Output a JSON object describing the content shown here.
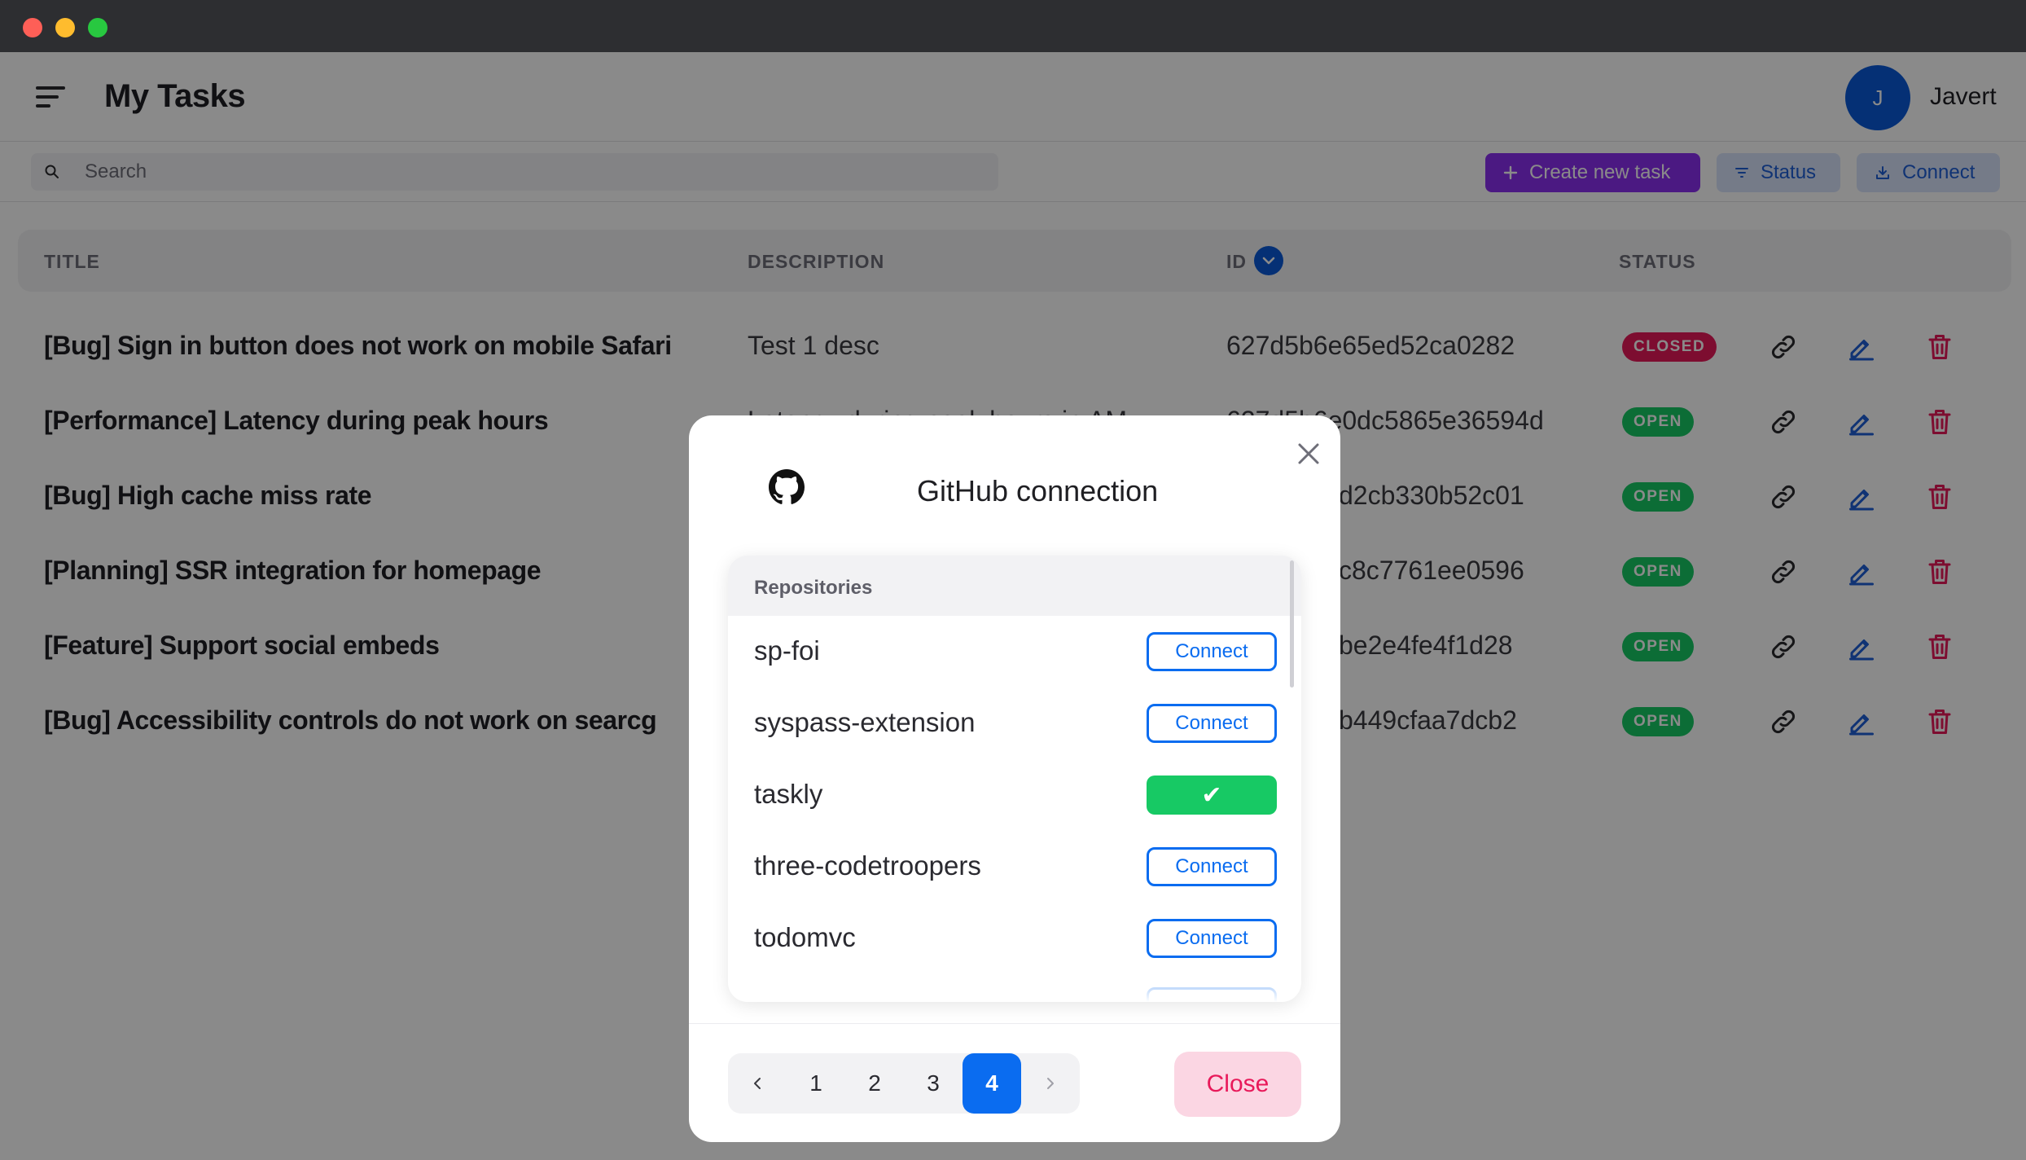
{
  "app": {
    "title": "My Tasks",
    "user_initial": "J",
    "user_name": "Javert"
  },
  "search": {
    "placeholder": "Search"
  },
  "toolbar": {
    "create_label": "Create new task",
    "status_label": "Status",
    "connect_label": "Connect"
  },
  "table": {
    "headers": {
      "title": "TITLE",
      "description": "DESCRIPTION",
      "id": "ID",
      "status": "STATUS"
    },
    "rows": [
      {
        "title": "[Bug] Sign in button does not work on mobile Safari",
        "description": "Test 1 desc",
        "id": "627d5b6e65ed52ca0282",
        "status": "CLOSED"
      },
      {
        "title": "[Performance] Latency during peak hours",
        "description": "Latency during peak hours in AM",
        "id": "627d5b6e0dc5865e36594d",
        "status": "OPEN"
      },
      {
        "title": "[Bug] High cache miss rate",
        "description": "",
        "id": "d2cb330b52c01",
        "status": "OPEN"
      },
      {
        "title": "[Planning] SSR integration for homepage",
        "description": "",
        "id": "c8c7761ee0596",
        "status": "OPEN"
      },
      {
        "title": "[Feature] Support social embeds",
        "description": "",
        "id": "be2e4fe4f1d28",
        "status": "OPEN"
      },
      {
        "title": "[Bug] Accessibility controls do not work on searcg",
        "description": "",
        "id": "b449cfaa7dcb2",
        "status": "OPEN"
      }
    ]
  },
  "modal": {
    "title": "GitHub connection",
    "repositories_label": "Repositories",
    "repos": [
      {
        "name": "sp-foi",
        "button": "Connect",
        "connected": false
      },
      {
        "name": "syspass-extension",
        "button": "Connect",
        "connected": false
      },
      {
        "name": "taskly",
        "button": "✔",
        "connected": true
      },
      {
        "name": "three-codetroopers",
        "button": "Connect",
        "connected": false
      },
      {
        "name": "todomvc",
        "button": "Connect",
        "connected": false
      }
    ],
    "pagination": {
      "pages": [
        "1",
        "2",
        "3",
        "4"
      ],
      "current": "4"
    },
    "close_label": "Close"
  },
  "colors": {
    "accent": "#0a6cf0",
    "purple": "#8b2ff0",
    "open": "#17c964",
    "closed": "#e8195a",
    "avatar": "#0a5ad9"
  }
}
